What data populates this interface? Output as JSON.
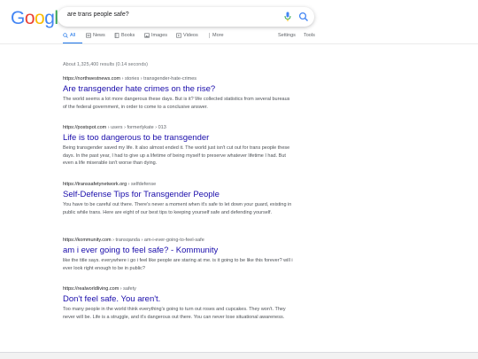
{
  "logo": {
    "letters": [
      "G",
      "o",
      "o",
      "g",
      "l",
      "e"
    ],
    "colors": [
      "#4285f4",
      "#ea4335",
      "#fbbc05",
      "#4285f4",
      "#34a853",
      "#ea4335"
    ]
  },
  "search": {
    "query": "are trans people safe?"
  },
  "tabs": [
    {
      "label": "All",
      "icon": "search-icon"
    },
    {
      "label": "News",
      "icon": "news-icon"
    },
    {
      "label": "Books",
      "icon": "book-icon"
    },
    {
      "label": "Images",
      "icon": "image-icon"
    },
    {
      "label": "Videos",
      "icon": "video-icon"
    },
    {
      "label": "More",
      "icon": "more-icon"
    }
  ],
  "tools": {
    "settings": "Settings",
    "tools": "Tools"
  },
  "stats": "About 1,325,400 results (0.14 seconds)",
  "results": [
    {
      "site": "https://northwestnews.com",
      "path": " › stories › transgender-hate-crimes",
      "title": "Are transgender hate crimes on the rise?",
      "snippet": "The world seems a lot more dangerous these days. But is it? We collected statistics from several bureaus of the federal government, in order to come to a conclusive answer."
    },
    {
      "site": "https://postspot.com",
      "path": " › users › formerlykate › 013",
      "title": "Life is too dangerous to be transgender",
      "snippet": "Being transgender saved my life. It also almost ended it. The world just isn't cut out for trans people these days. In the past year, I had to give up a lifetime of being myself to preserve whatever lifetime I had. But even a life miserable isn't worse than dying."
    },
    {
      "site": "https://transsafetynetwork.org",
      "path": " › selfdefense",
      "title": "Self-Defense Tips for Transgender People",
      "snippet": "You have to be careful out there. There's never a moment when it's safe to let down your guard, existing in public while trans. Here are eight of our best tips to keeping yourself safe and defending yourself."
    },
    {
      "site": "https://kommunity.com",
      "path": " › transqanda › am-i-ever-going-to-feel-safe",
      "title": "am i ever going to feel safe? - Kommunity",
      "snippet": "like the title says. everywhere i go i feel like people are staring at me. is it going to be like this forever? will i ever look right enough to be in public?"
    },
    {
      "site": "https://realworldliving.com",
      "path": " › safety",
      "title": "Don't feel safe. You aren't.",
      "snippet": "Too many people in the world think everything's going to turn out roses and cupcakes. They won't. They never will be. Life is a struggle, and it's dangerous out there. You can never lose situational awareness."
    }
  ]
}
